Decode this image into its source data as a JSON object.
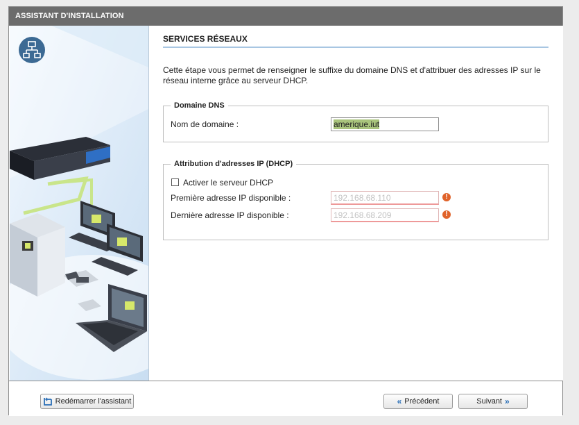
{
  "window": {
    "title": "ASSISTANT D'INSTALLATION"
  },
  "section": {
    "title": "SERVICES RÉSEAUX",
    "intro": "Cette étape vous permet de renseigner le suffixe du domaine DNS et d'attribuer des adresses IP sur le réseau interne grâce au serveur DHCP."
  },
  "dns": {
    "legend": "Domaine DNS",
    "domain_label": "Nom de domaine :",
    "domain_value": "amerique.iut"
  },
  "dhcp": {
    "legend": "Attribution d'adresses IP (DHCP)",
    "enable_label": "Activer le serveur DHCP",
    "enable_checked": false,
    "first_ip_label": "Première adresse IP disponible :",
    "first_ip_value": "192.168.68.110",
    "last_ip_label": "Dernière adresse IP disponible :",
    "last_ip_value": "192.168.68.209",
    "warning_glyph": "!"
  },
  "footer": {
    "restart_label": "Redémarrer l'assistant",
    "previous_label": "Précédent",
    "next_label": "Suivant"
  },
  "icons": {
    "network": "network-icon",
    "restart": "restart-icon",
    "previous": "double-chevron-left-icon",
    "next": "double-chevron-right-icon",
    "warning": "warning-icon"
  },
  "colors": {
    "titlebar": "#6c6c6c",
    "accent_blue": "#2a6fb7",
    "section_underline": "#a8c6e2",
    "field_highlight": "#a9c47c",
    "warning": "#e0632a"
  }
}
